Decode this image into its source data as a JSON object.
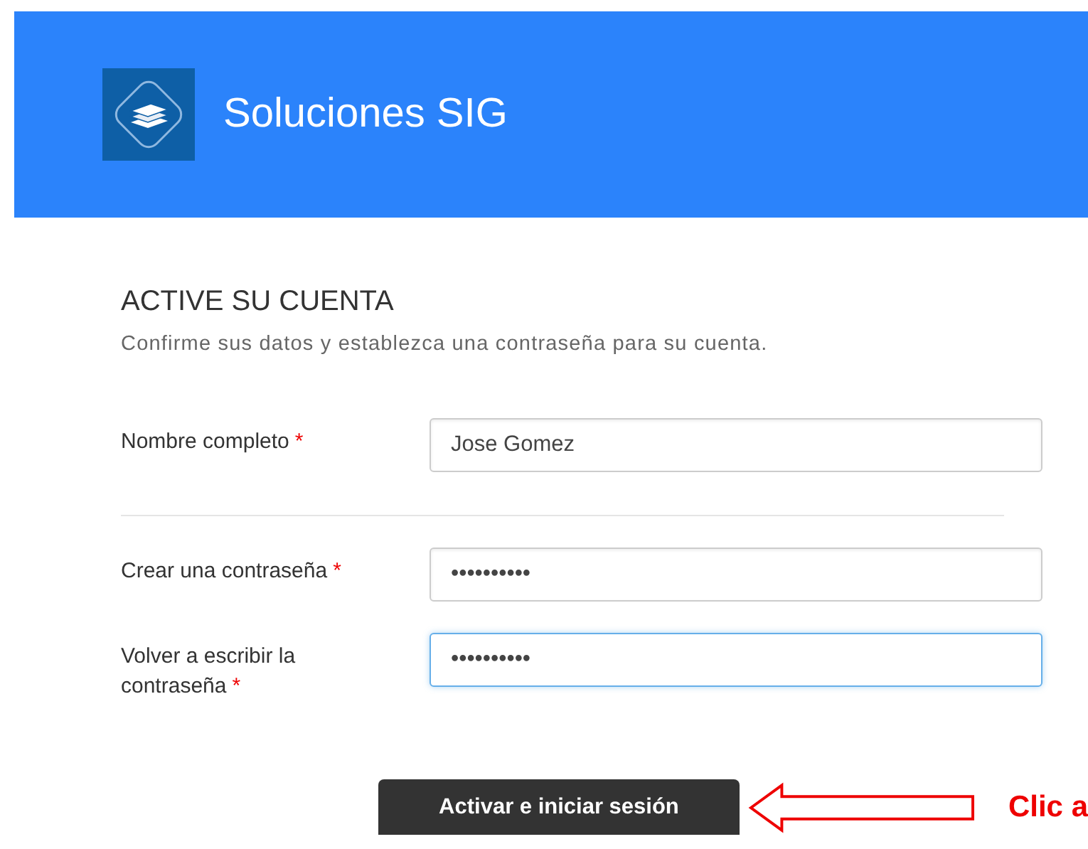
{
  "header": {
    "title": "Soluciones SIG"
  },
  "form": {
    "heading": "ACTIVE SU CUENTA",
    "subtitle": "Confirme sus datos y establezca una contraseña para su cuenta.",
    "field_groups": [
      [
        {
          "label": "Nombre completo",
          "required_mark": "*",
          "value": "Jose Gomez",
          "kind": "text",
          "focused": false
        }
      ],
      [
        {
          "label": "Crear una contraseña",
          "required_mark": "*",
          "value": "••••••••••",
          "kind": "password",
          "focused": false
        },
        {
          "label": "Volver a escribir la contraseña",
          "required_mark": "*",
          "value": "••••••••••",
          "kind": "password",
          "focused": true
        }
      ]
    ],
    "submit": "Activar e iniciar sesión"
  },
  "annotation": {
    "text": "Clic a"
  }
}
